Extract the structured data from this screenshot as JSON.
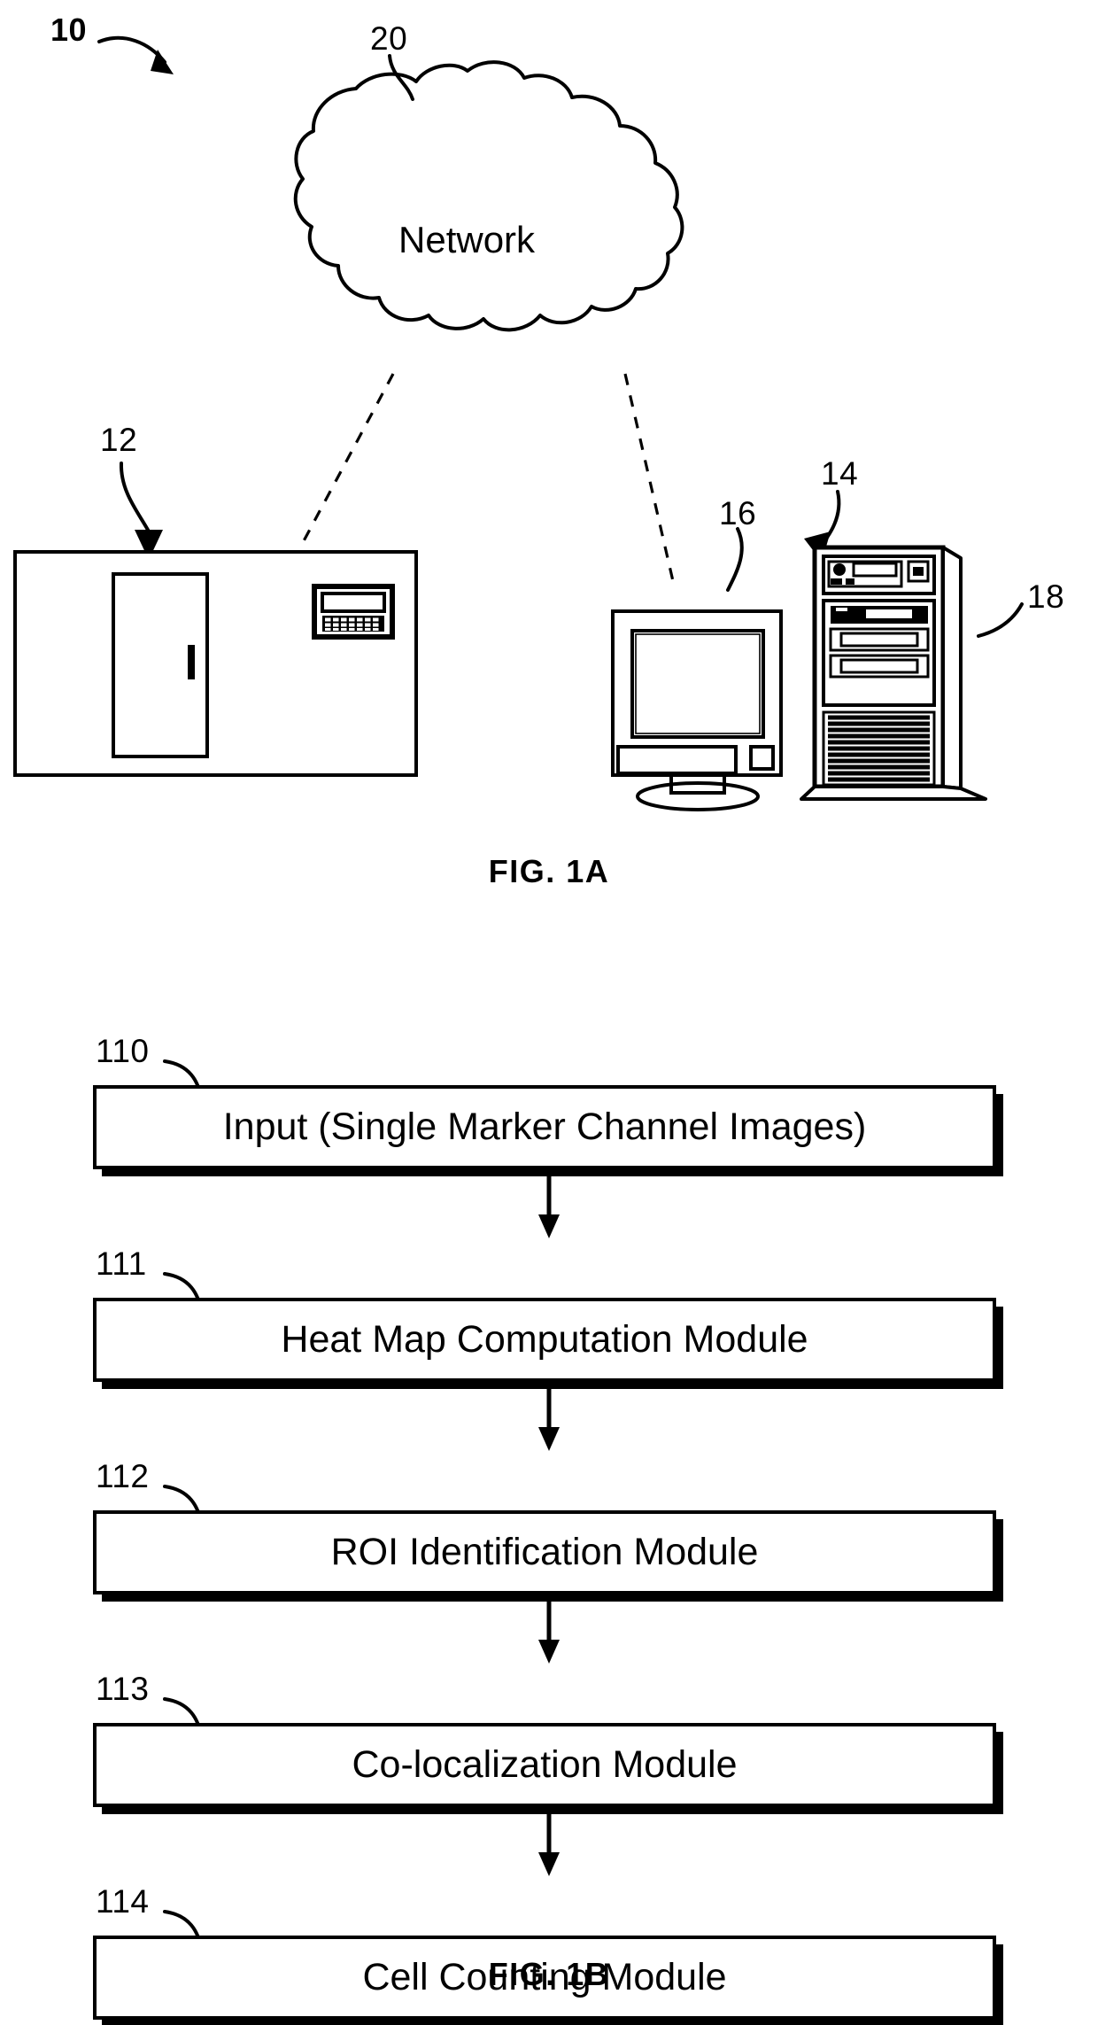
{
  "document": {
    "type": "patent-drawing-sheet",
    "figures": [
      "FIG. 1A",
      "FIG. 1B"
    ]
  },
  "fig1a": {
    "caption": "FIG. 1A",
    "system_numeral": "10",
    "cloud": {
      "label": "Network",
      "numeral": "20"
    },
    "nodes": [
      {
        "numeral": "12",
        "name": "scanner-instrument"
      },
      {
        "numeral": "14",
        "name": "computer-system"
      },
      {
        "numeral": "16",
        "name": "monitor-display"
      },
      {
        "numeral": "18",
        "name": "computer-tower"
      }
    ]
  },
  "fig1b": {
    "caption": "FIG. 1B",
    "steps": [
      {
        "numeral": "110",
        "label": "Input (Single Marker Channel Images)"
      },
      {
        "numeral": "111",
        "label": "Heat Map Computation Module"
      },
      {
        "numeral": "112",
        "label": "ROI Identification Module"
      },
      {
        "numeral": "113",
        "label": "Co-localization Module"
      },
      {
        "numeral": "114",
        "label": "Cell Counting Module"
      }
    ]
  },
  "colors": {
    "ink": "#000000",
    "paper": "#ffffff"
  }
}
